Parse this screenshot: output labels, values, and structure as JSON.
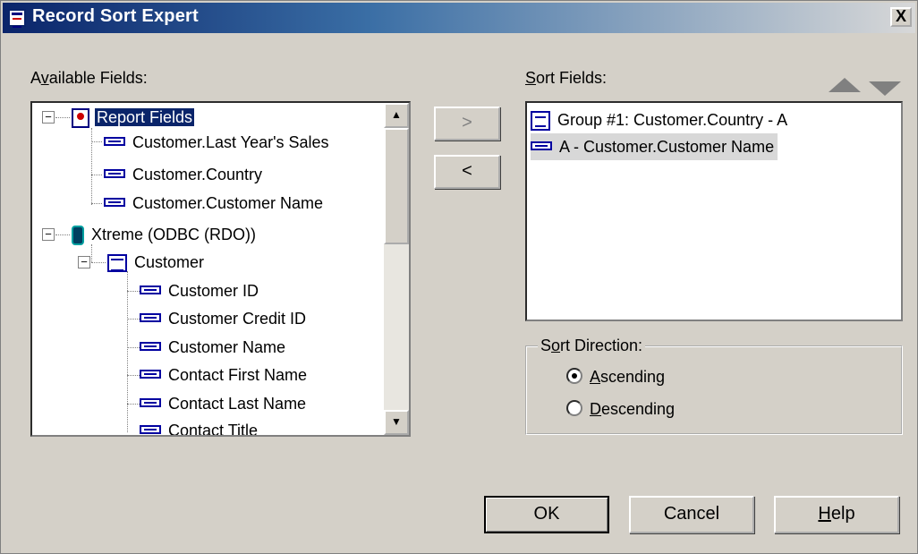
{
  "window": {
    "title": "Record Sort Expert",
    "close_label": "X"
  },
  "available_fields": {
    "label_pre": "A",
    "label_accel": "v",
    "label_post": "ailable Fields:",
    "tree": [
      {
        "label": "Report Fields",
        "icon": "report-icon"
      },
      {
        "label": "Customer.Last Year's Sales",
        "icon": "field-icon"
      },
      {
        "label": "Customer.Country",
        "icon": "field-icon"
      },
      {
        "label": "Customer.Customer Name",
        "icon": "field-icon"
      },
      {
        "label": "Xtreme (ODBC (RDO))",
        "icon": "database-icon"
      },
      {
        "label": "Customer",
        "icon": "table-icon"
      },
      {
        "label": "Customer ID",
        "icon": "field-icon"
      },
      {
        "label": "Customer Credit ID",
        "icon": "field-icon"
      },
      {
        "label": "Customer Name",
        "icon": "field-icon"
      },
      {
        "label": "Contact First Name",
        "icon": "field-icon"
      },
      {
        "label": "Contact Last Name",
        "icon": "field-icon"
      },
      {
        "label": "Contact Title",
        "icon": "field-icon"
      }
    ]
  },
  "move": {
    "add_label": ">",
    "remove_label": "<"
  },
  "sort_fields": {
    "label_accel": "S",
    "label_post": "ort Fields:",
    "items": [
      {
        "label": "Group #1: Customer.Country - A",
        "icon": "group-icon"
      },
      {
        "label": "A - Customer.Customer Name",
        "icon": "field-icon"
      }
    ]
  },
  "sort_direction": {
    "title_pre": "S",
    "title_accel": "o",
    "title_post": "rt Direction:",
    "options": [
      {
        "accel": "A",
        "rest": "scending",
        "selected": true
      },
      {
        "accel": "D",
        "rest": "escending",
        "selected": false
      }
    ]
  },
  "buttons": {
    "ok_label": "OK",
    "cancel_label": "Cancel",
    "help_accel": "H",
    "help_rest": "elp"
  },
  "colors": {
    "selection": "#0a246a",
    "face": "#d4d0c8"
  }
}
